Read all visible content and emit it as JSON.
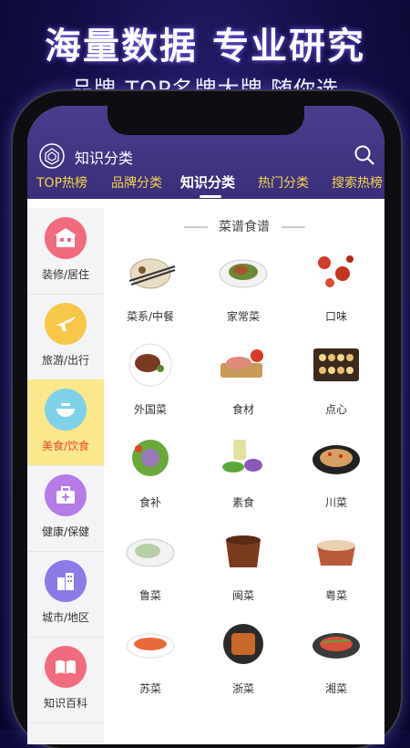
{
  "promo": {
    "title": "海量数据 专业研究",
    "subtitle": "品牌-TOP名牌大牌 随你选"
  },
  "header": {
    "title": "知识分类"
  },
  "tabs": [
    {
      "label": "TOP热榜"
    },
    {
      "label": "品牌分类"
    },
    {
      "label": "知识分类"
    },
    {
      "label": "热门分类"
    },
    {
      "label": "搜索热榜"
    }
  ],
  "sidebar": {
    "items": [
      {
        "label": "装修/居住",
        "icon": "house-icon",
        "color": "#f06b7d"
      },
      {
        "label": "旅游/出行",
        "icon": "plane-icon",
        "color": "#f7c74a"
      },
      {
        "label": "美食/饮食",
        "icon": "bowl-icon",
        "color": "#7fd1e8"
      },
      {
        "label": "健康/保健",
        "icon": "medkit-icon",
        "color": "#b57be6"
      },
      {
        "label": "城市/地区",
        "icon": "building-icon",
        "color": "#8a7be6"
      },
      {
        "label": "知识百科",
        "icon": "book-icon",
        "color": "#f06b7d"
      }
    ]
  },
  "section": {
    "title": "菜谱食谱"
  },
  "grid": [
    {
      "label": "菜系/中餐"
    },
    {
      "label": "家常菜"
    },
    {
      "label": "口味"
    },
    {
      "label": "外国菜"
    },
    {
      "label": "食材"
    },
    {
      "label": "点心"
    },
    {
      "label": "食补"
    },
    {
      "label": "素食"
    },
    {
      "label": "川菜"
    },
    {
      "label": "鲁菜"
    },
    {
      "label": "闽菜"
    },
    {
      "label": "粤菜"
    },
    {
      "label": "苏菜"
    },
    {
      "label": "浙菜"
    },
    {
      "label": "湘菜"
    }
  ],
  "colors": {
    "header": "#3a2f7a",
    "tab_inactive": "#f7d54a",
    "active_sidebar_bg": "#fbe88c",
    "active_sidebar_text": "#e84a2a"
  }
}
